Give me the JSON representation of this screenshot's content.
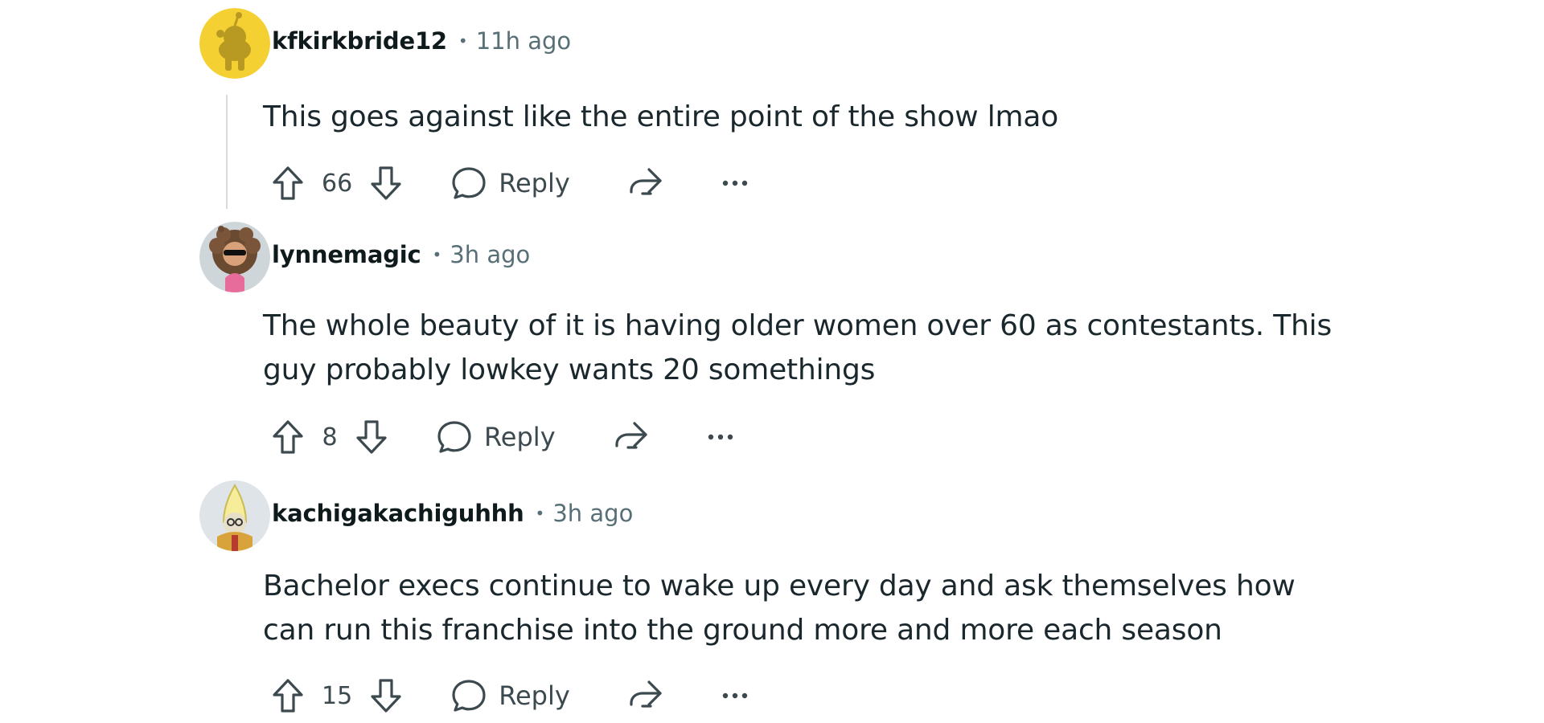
{
  "comments": [
    {
      "username": "kfkirkbride12",
      "separator": "•",
      "time": "11h ago",
      "body": "This goes against like the entire point of the show lmao",
      "score": "66",
      "reply_label": "Reply",
      "avatar_color": "#f5d033",
      "icons": [
        "upvote-icon",
        "downvote-icon",
        "comment-icon",
        "share-icon",
        "more-icon"
      ]
    },
    {
      "username": "lynnemagic",
      "separator": "•",
      "time": "3h ago",
      "body": "The whole beauty of it is having older women over 60 as contestants. This guy probably lowkey wants 20 somethings",
      "score": "8",
      "reply_label": "Reply",
      "avatar_color": "#cfd6da",
      "icons": [
        "upvote-icon",
        "downvote-icon",
        "comment-icon",
        "share-icon",
        "more-icon"
      ]
    },
    {
      "username": "kachigakachiguhhh",
      "separator": "•",
      "time": "3h ago",
      "body": "Bachelor execs continue to wake up every day and ask themselves how can run this franchise into the ground more and more each season",
      "score": "15",
      "reply_label": "Reply",
      "avatar_color": "#dfe4e8",
      "icons": [
        "upvote-icon",
        "downvote-icon",
        "comment-icon",
        "share-icon",
        "more-icon"
      ]
    }
  ],
  "colors": {
    "username": "#0f1a1c",
    "meta": "#576f76",
    "body": "#1a282d",
    "icon": "#3c4a4f",
    "thread_line": "#d8dadc"
  }
}
